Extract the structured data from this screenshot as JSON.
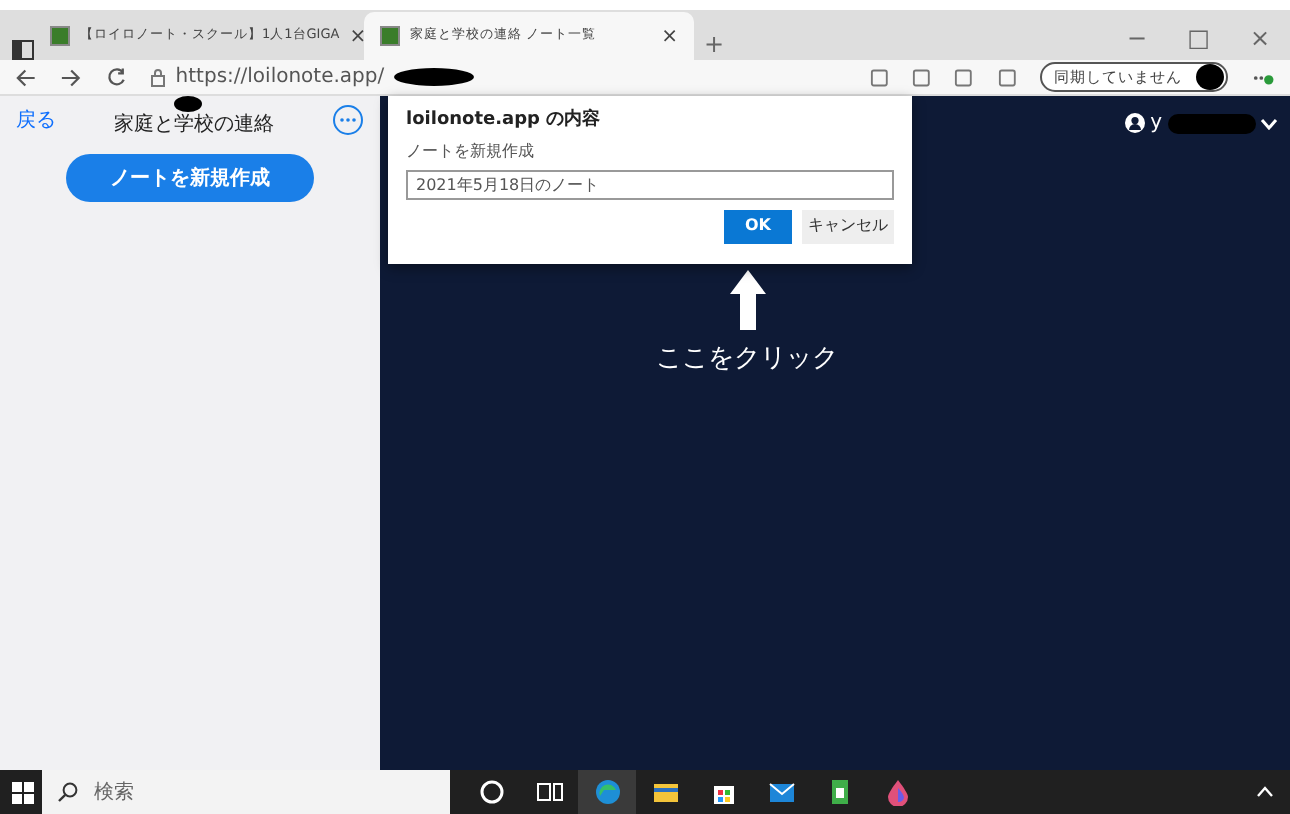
{
  "browser": {
    "tabs": [
      {
        "title": "【ロイロノート・スクール】1人1台GIGA",
        "selected": false,
        "close": "×"
      },
      {
        "title": "家庭と学校の連絡 ノート一覧",
        "selected": true,
        "close": "×"
      }
    ],
    "new_tab": "+",
    "window_controls": [
      "−",
      "□",
      "×"
    ],
    "address": "https://loilonote.app/",
    "sync_button": "同期していません"
  },
  "sidebar": {
    "back": "戻る",
    "title": "家庭と学校の連絡",
    "new_note_button": "ノートを新規作成"
  },
  "main": {
    "user": "y",
    "hint": "ここをクリック"
  },
  "dialog": {
    "title": "loilonote.app の内容",
    "label": "ノートを新規作成",
    "value": "2021年5月18日のノート",
    "buttons": [
      {
        "label": "OK",
        "kind": "primary"
      },
      {
        "label": "キャンセル",
        "kind": "secondary"
      }
    ]
  },
  "taskbar": {
    "search_placeholder": "検索"
  }
}
